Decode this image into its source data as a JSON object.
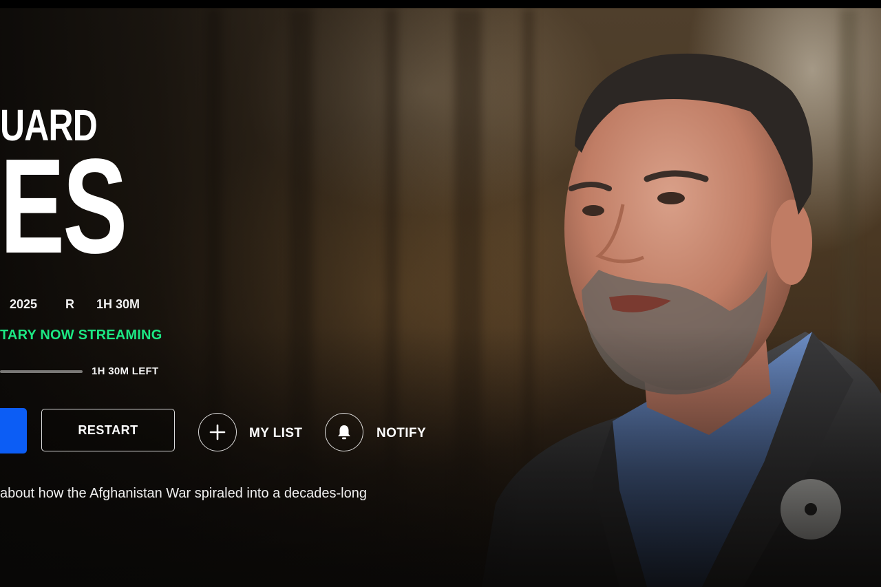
{
  "hero": {
    "title_top": "UARD",
    "title_main": "ES",
    "year": "2025",
    "rating": "R",
    "duration": "1H 30M",
    "status": "TARY NOW STREAMING",
    "progress_fraction": 0.0,
    "time_left": "1H 30M LEFT",
    "description": "about how the Afghanistan War spiraled into a decades-long"
  },
  "actions": {
    "restart_label": "RESTART",
    "mylist_label": "MY LIST",
    "notify_label": "NOTIFY"
  },
  "icons": {
    "play": "play-button",
    "add": "plus-icon",
    "notify": "bell-icon"
  },
  "colors": {
    "accent_play": "#0c5df5",
    "status_green": "#1ce783"
  }
}
